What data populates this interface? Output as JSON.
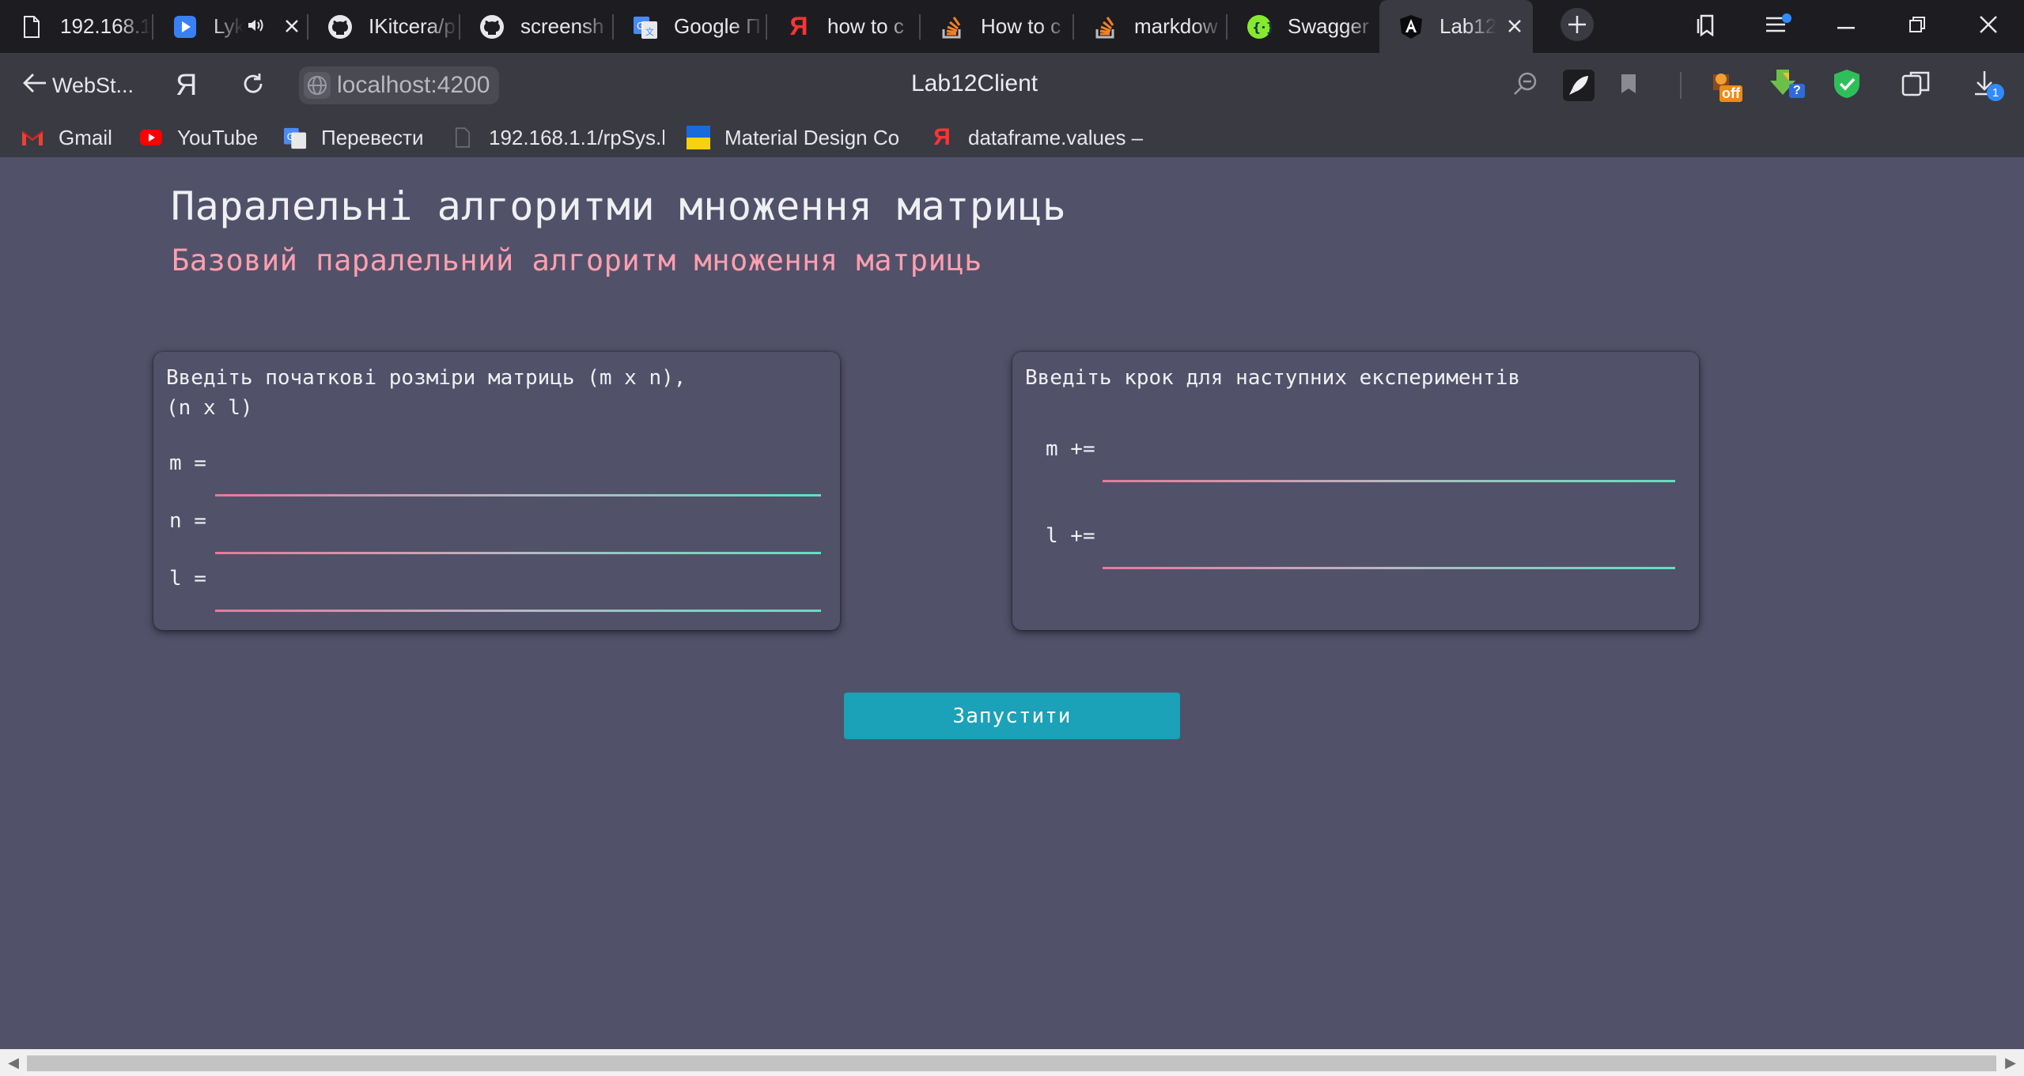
{
  "tabs": [
    {
      "label": "192.168.1",
      "icon": "page-icon"
    },
    {
      "label": "Lyk",
      "icon": "youtube-play-icon",
      "audio": true
    },
    {
      "label": "IKitcera/p",
      "icon": "github-icon"
    },
    {
      "label": "screensh",
      "icon": "github-icon"
    },
    {
      "label": "Google П",
      "icon": "google-translate-icon"
    },
    {
      "label": "how to c",
      "icon": "yandex-icon"
    },
    {
      "label": "How to c",
      "icon": "stackoverflow-icon"
    },
    {
      "label": "markdow",
      "icon": "stackoverflow-icon"
    },
    {
      "label": "Swagger",
      "icon": "swagger-icon"
    },
    {
      "label": "Lab12",
      "icon": "angular-icon",
      "active": true
    }
  ],
  "toolbar": {
    "back_label": "WebSt...",
    "yandex_letter": "Я",
    "url": "localhost:4200",
    "page_title": "Lab12Client",
    "downloads_badge": "1",
    "adblock_badge": "off",
    "ext_badge": "?"
  },
  "bookmarks": [
    {
      "label": "Gmail",
      "icon": "gmail-icon"
    },
    {
      "label": "YouTube",
      "icon": "youtube-icon"
    },
    {
      "label": "Перевести",
      "icon": "google-translate-icon"
    },
    {
      "label": "192.168.1.1/rpSys.h",
      "icon": "page-icon"
    },
    {
      "label": "Material Design Co",
      "icon": "ukraine-flag-icon"
    },
    {
      "label": "dataframe.values –",
      "icon": "yandex-icon"
    }
  ],
  "page": {
    "title": "Паралельні алгоритми множення матриць",
    "subtitle": "Базовий паралельний алгоритм множення матриць",
    "left_card": {
      "title_line1": "Введіть початкові розміри матриць (m x n),",
      "title_line2": "(n x l)",
      "fields": [
        {
          "label": "m =",
          "value": ""
        },
        {
          "label": "n =",
          "value": ""
        },
        {
          "label": "l =",
          "value": ""
        }
      ]
    },
    "right_card": {
      "title": "Введіть крок для наступних експериментів",
      "fields": [
        {
          "label": "m +=",
          "value": ""
        },
        {
          "label": "l +=",
          "value": ""
        }
      ]
    },
    "run_button": "Запустити"
  },
  "colors": {
    "page_bg": "#52516a",
    "title": "#f0f0f4",
    "subtitle": "#ff9fae",
    "button": "#1ba1b8",
    "underline_start": "#e8789b",
    "underline_end": "#5fe0c0"
  }
}
